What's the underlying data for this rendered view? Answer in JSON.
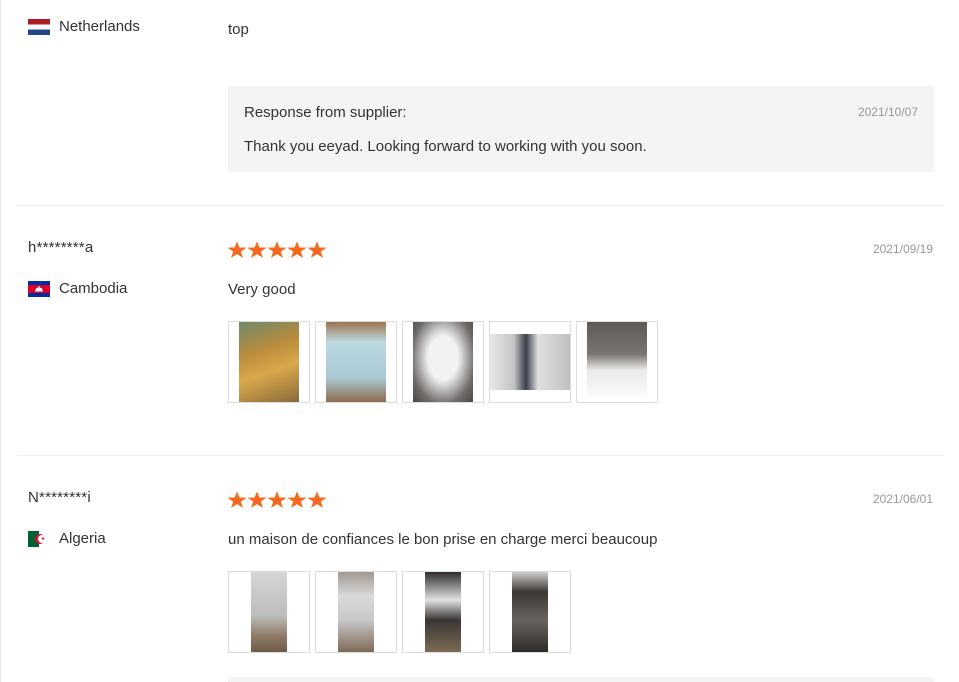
{
  "reviews": [
    {
      "country": "Netherlands",
      "flag_icon": "netherlands-flag-icon",
      "text": "top",
      "response": {
        "label": "Response from supplier:",
        "date": "2021/10/07",
        "text": "Thank you eeyad. Looking forward to working with you soon."
      }
    },
    {
      "user": "h********a",
      "country": "Cambodia",
      "flag_icon": "cambodia-flag-icon",
      "rating": 5,
      "date": "2021/09/19",
      "text": "Very good",
      "photo_count": 5
    },
    {
      "user": "N********i",
      "country": "Algeria",
      "flag_icon": "algeria-flag-icon",
      "rating": 5,
      "date": "2021/06/01",
      "text": "un maison de confiances le bon prise en charge merci beaucoup",
      "photo_count": 4
    }
  ],
  "colors": {
    "star": "#f5681e",
    "date": "#999999",
    "response_bg": "#f4f4f4",
    "divider": "#eeeeee"
  }
}
